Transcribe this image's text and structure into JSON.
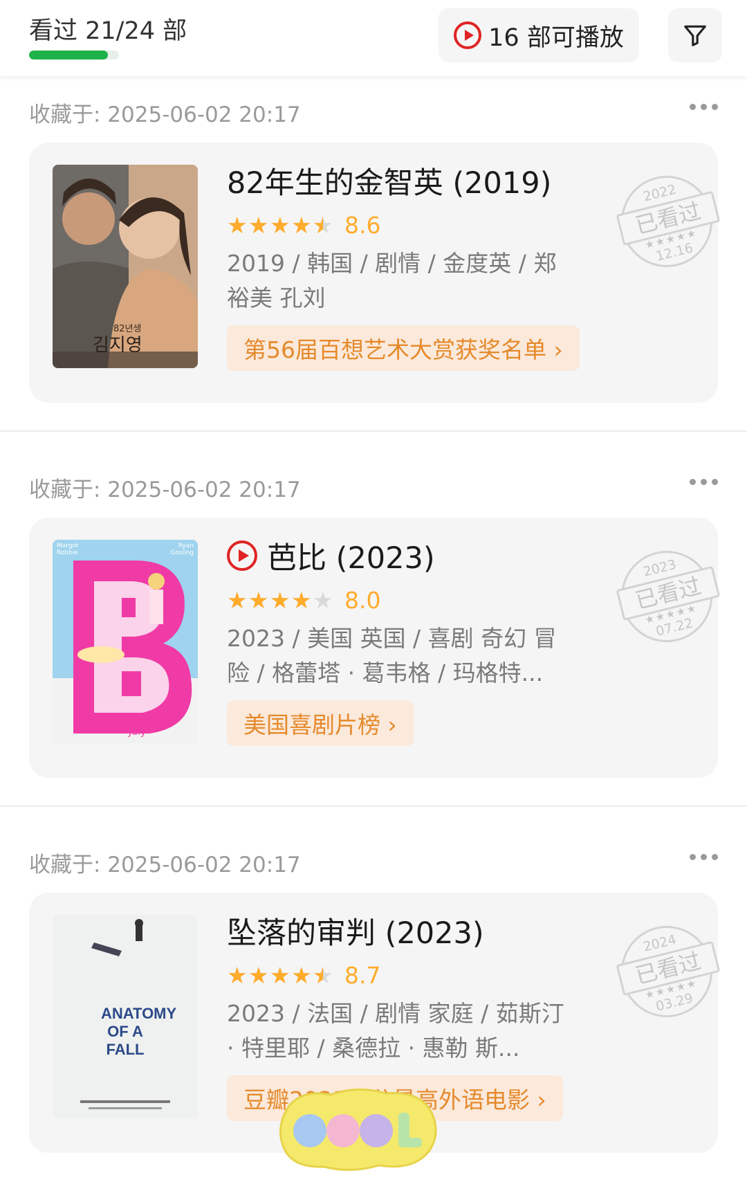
{
  "header": {
    "watch_count": "看过 21/24 部",
    "progress": 0.875,
    "play_label": "16 部可播放",
    "filter_icon": "filter-icon"
  },
  "items": [
    {
      "collected": "收藏于: 2025-06-02 20:17",
      "title": "82年生的金智英 (2019)",
      "playable": false,
      "rating": 4.5,
      "score": "8.6",
      "info": "2019 / 韩国 / 剧情 / 金度英 / 郑裕美 孔刘",
      "tag": "第56届百想艺术大赏获奖名单 ›",
      "stamp": {
        "year": "2022",
        "text": "已看过",
        "stars": "★★★★★",
        "date": "12.16"
      }
    },
    {
      "collected": "收藏于: 2025-06-02 20:17",
      "title": "芭比 (2023)",
      "playable": true,
      "rating": 4,
      "score": "8.0",
      "info": "2023 / 美国 英国 / 喜剧 奇幻 冒险 / 格蕾塔 · 葛韦格 / 玛格特...",
      "tag": "美国喜剧片榜 ›",
      "stamp": {
        "year": "2023",
        "text": "已看过",
        "stars": "★★★★★",
        "date": "07.22"
      }
    },
    {
      "collected": "收藏于: 2025-06-02 20:17",
      "title": "坠落的审判 (2023)",
      "playable": false,
      "rating": 4.5,
      "score": "8.7",
      "info": "2023 / 法国 / 剧情 家庭 / 茹斯汀 · 特里耶 / 桑德拉 · 惠勒 斯...",
      "tag": "豆瓣2023评分最高外语电影 ›",
      "stamp": {
        "year": "2024",
        "text": "已看过",
        "stars": "★★★★★",
        "date": "03.29"
      }
    }
  ],
  "posters": {
    "p1": {
      "kr_small": "82년생",
      "kr_title": "김지영"
    },
    "p2": {
      "letter": "B",
      "top_left": "Margot Robbie",
      "top_right": "Ryan Gosling",
      "bottom": "July"
    },
    "p3": {
      "title": "ANATOMY OF A FALL"
    }
  },
  "sticker_text": "COOL",
  "colors": {
    "accent_green": "#20b24a",
    "play_red": "#e02424",
    "star": "#ffac2d",
    "tag_text": "#e58a2c",
    "tag_bg": "#fbe9db"
  }
}
